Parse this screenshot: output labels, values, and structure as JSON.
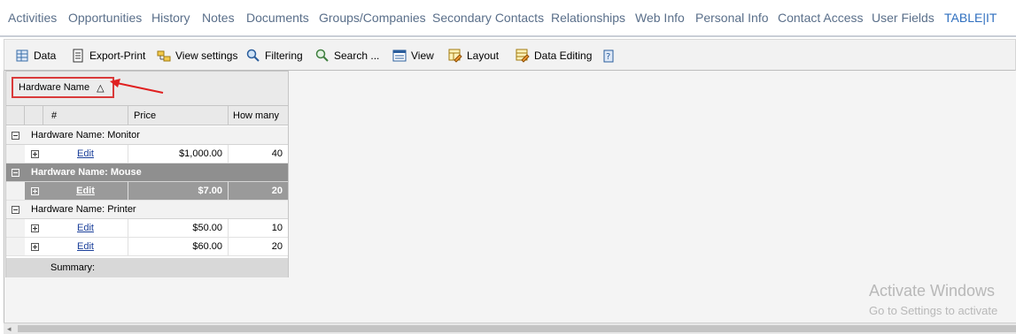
{
  "tabs": [
    {
      "label": "Activities"
    },
    {
      "label": "Opportunities"
    },
    {
      "label": "History"
    },
    {
      "label": "Notes"
    },
    {
      "label": "Documents"
    },
    {
      "label": "Groups/Companies"
    },
    {
      "label": "Secondary Contacts"
    },
    {
      "label": "Relationships"
    },
    {
      "label": "Web Info"
    },
    {
      "label": "Personal Info"
    },
    {
      "label": "Contact Access"
    },
    {
      "label": "User Fields"
    },
    {
      "label": "TABLE|IT",
      "active": true
    }
  ],
  "toolbar": {
    "data": "Data",
    "export_print": "Export-Print",
    "view_settings": "View settings",
    "filtering": "Filtering",
    "search": "Search ...",
    "view": "View",
    "layout": "Layout",
    "data_editing": "Data Editing"
  },
  "group_panel": {
    "chip_label": "Hardware Name",
    "sort_glyph": "△"
  },
  "columns": {
    "number": "#",
    "price": "Price",
    "how_many": "How many"
  },
  "groups": [
    {
      "label": "Hardware Name: Monitor",
      "rows": [
        {
          "action": "Edit",
          "price": "$1,000.00",
          "how_many": "40"
        }
      ]
    },
    {
      "label": "Hardware Name: Mouse",
      "selected": true,
      "rows": [
        {
          "action": "Edit",
          "price": "$7.00",
          "how_many": "20"
        }
      ]
    },
    {
      "label": "Hardware Name: Printer",
      "rows": [
        {
          "action": "Edit",
          "price": "$50.00",
          "how_many": "10"
        },
        {
          "action": "Edit",
          "price": "$60.00",
          "how_many": "20"
        }
      ]
    }
  ],
  "summary_label": "Summary:",
  "watermark": {
    "title": "Activate Windows",
    "subtitle": "Go to Settings to activate"
  },
  "colors": {
    "accent": "#2f6fbf",
    "highlight_border": "#d93a3a",
    "selected_row": "#8f8f8f"
  }
}
